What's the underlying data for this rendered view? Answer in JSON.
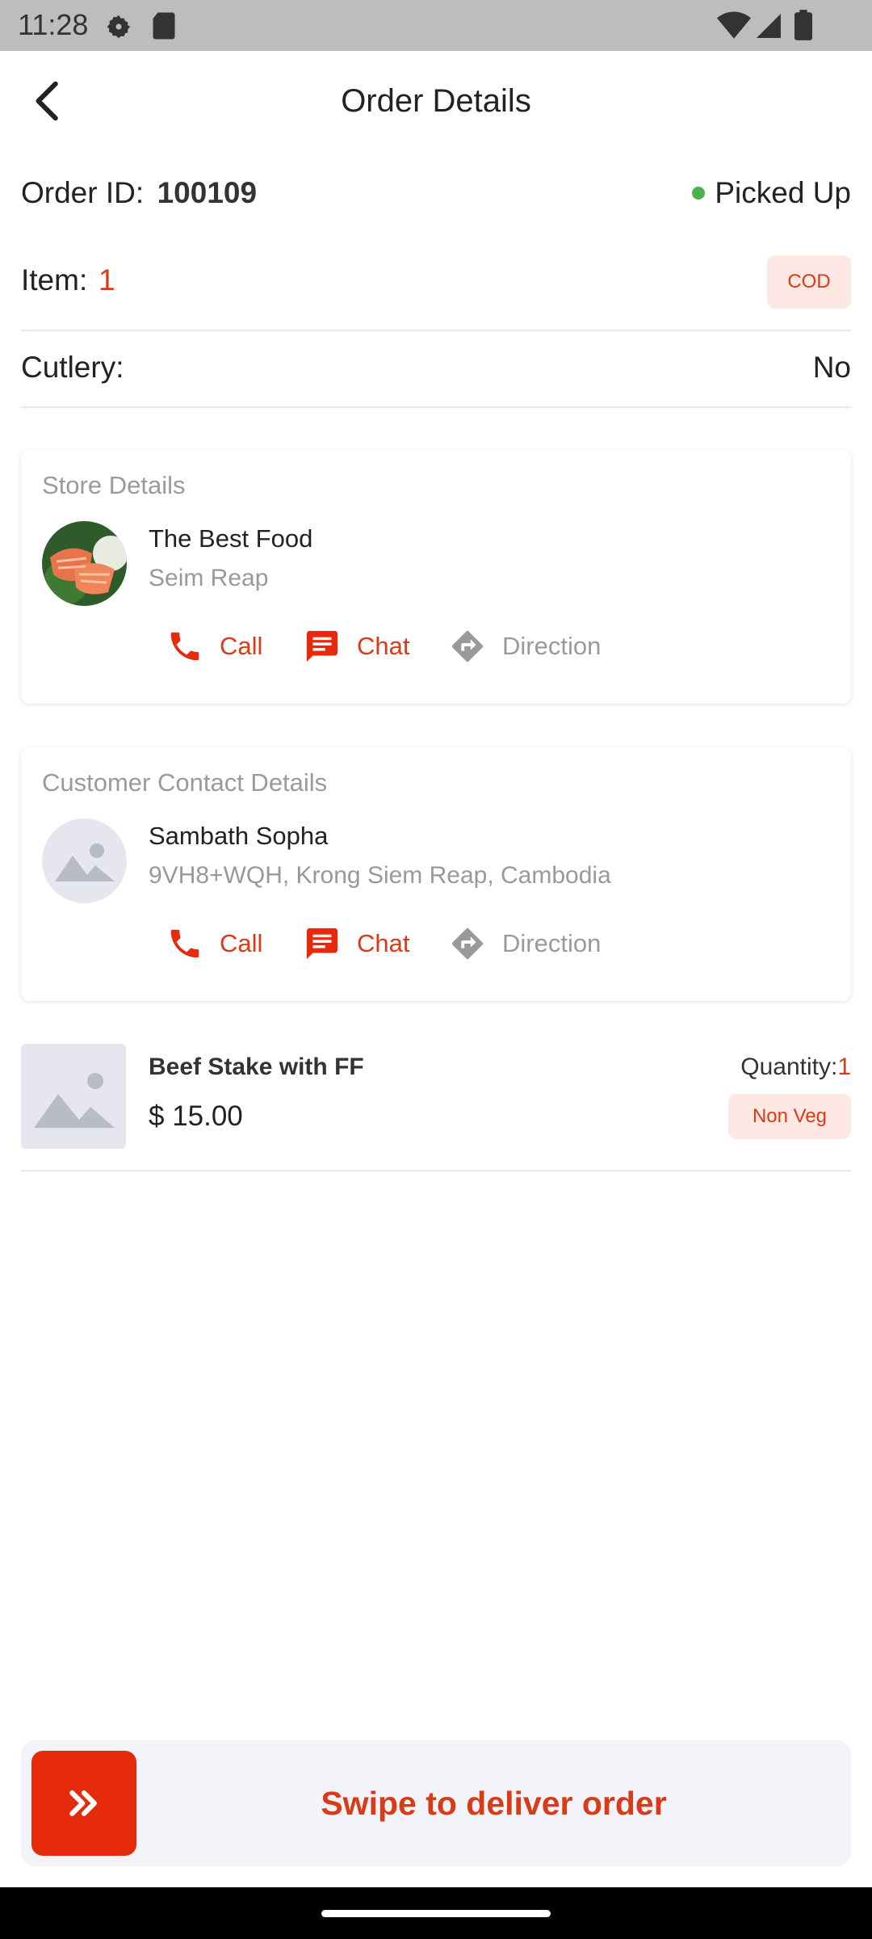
{
  "status_bar": {
    "time": "11:28"
  },
  "header": {
    "title": "Order Details"
  },
  "order": {
    "id_label": "Order ID:",
    "id_value": "100109",
    "status": "Picked Up",
    "status_color": "#4caf50",
    "item_label": "Item:",
    "item_count": "1",
    "payment_badge": "COD",
    "cutlery_label": "Cutlery:",
    "cutlery_value": "No"
  },
  "store": {
    "section_title": "Store Details",
    "name": "The Best Food",
    "location": "Seim Reap",
    "actions": {
      "call": "Call",
      "chat": "Chat",
      "direction": "Direction"
    }
  },
  "customer": {
    "section_title": "Customer Contact Details",
    "name": "Sambath Sopha",
    "address": "9VH8+WQH, Krong Siem Reap, Cambodia",
    "actions": {
      "call": "Call",
      "chat": "Chat",
      "direction": "Direction"
    }
  },
  "product": {
    "name": "Beef Stake with FF",
    "price": "$ 15.00",
    "quantity_label": "Quantity:",
    "quantity_value": "1",
    "diet_badge": "Non Veg"
  },
  "swipe": {
    "label": "Swipe to deliver order"
  },
  "colors": {
    "accent": "#d93a17",
    "knob": "#e52b0b",
    "muted": "#9a9a9a"
  }
}
